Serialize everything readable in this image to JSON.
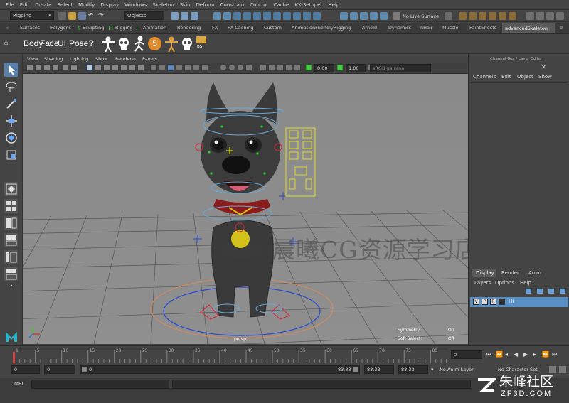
{
  "menubar": [
    "File",
    "Edit",
    "Create",
    "Select",
    "Modify",
    "Display",
    "Windows",
    "Skeleton",
    "Skin",
    "Deform",
    "Constrain",
    "Control",
    "Cache",
    "KX-Setuper",
    "Help"
  ],
  "status": {
    "mode": "Rigging",
    "objects": "Objects",
    "live": "No Live Surface"
  },
  "shelf_tabs": [
    "Surfaces",
    "Polygons",
    "Sculpting",
    "Rigging",
    "Animation",
    "Rendering",
    "FX",
    "FX Caching",
    "Custom",
    "AnimationFriendlyRigging",
    "Arnold",
    "Dynamics",
    "nHair",
    "Muscle",
    "PaintEffects"
  ],
  "shelf_active": "advancedSkeleton",
  "shelf": {
    "body": "Body",
    "face": "Face",
    "ui": "UI",
    "pose": "Pose",
    "help": "?",
    "count": "5",
    "bs": "BS"
  },
  "viewport_menu": [
    "View",
    "Shading",
    "Lighting",
    "Show",
    "Renderer",
    "Panels"
  ],
  "viewport_tools": {
    "val1": "0.00",
    "val2": "1.00",
    "color_space": "sRGB gamma"
  },
  "hud": {
    "symmetry_label": "Symmetry:",
    "symmetry_value": "On",
    "soft_label": "Soft Select:",
    "soft_value": "Off",
    "camera": "persp"
  },
  "watermark": "晨曦CG资源学习店",
  "channel_box": {
    "title": "Channel Box / Layer Editor",
    "menus": [
      "Channels",
      "Edit",
      "Object",
      "Show"
    ]
  },
  "layer_editor": {
    "tabs": [
      "Display",
      "Render",
      "Anim"
    ],
    "menus": [
      "Layers",
      "Options",
      "Help"
    ],
    "layer": {
      "v": "V",
      "p": "P",
      "r": "R",
      "name": "Hi"
    }
  },
  "timeline": {
    "ticks": [
      "1",
      "5",
      "10",
      "15",
      "20",
      "25",
      "30",
      "35",
      "40",
      "45",
      "50",
      "55",
      "60",
      "65",
      "70",
      "75",
      "80"
    ],
    "current": "0"
  },
  "range": {
    "start": "0",
    "anim_start": "0",
    "slider_start": "0",
    "slider_end": "83.33",
    "end": "83.33",
    "anim_end": "83.33",
    "anim_layer": "No Anim Layer",
    "char_set": "No Character Set"
  },
  "cmd": {
    "label": "MEL"
  },
  "logo": {
    "cn": "朱峰社区",
    "url": "ZF3D.COM"
  },
  "colors": {
    "accent": "#5a8fc4",
    "active_tab": "#5a5a5a",
    "viewport": "#8c8c8c"
  }
}
